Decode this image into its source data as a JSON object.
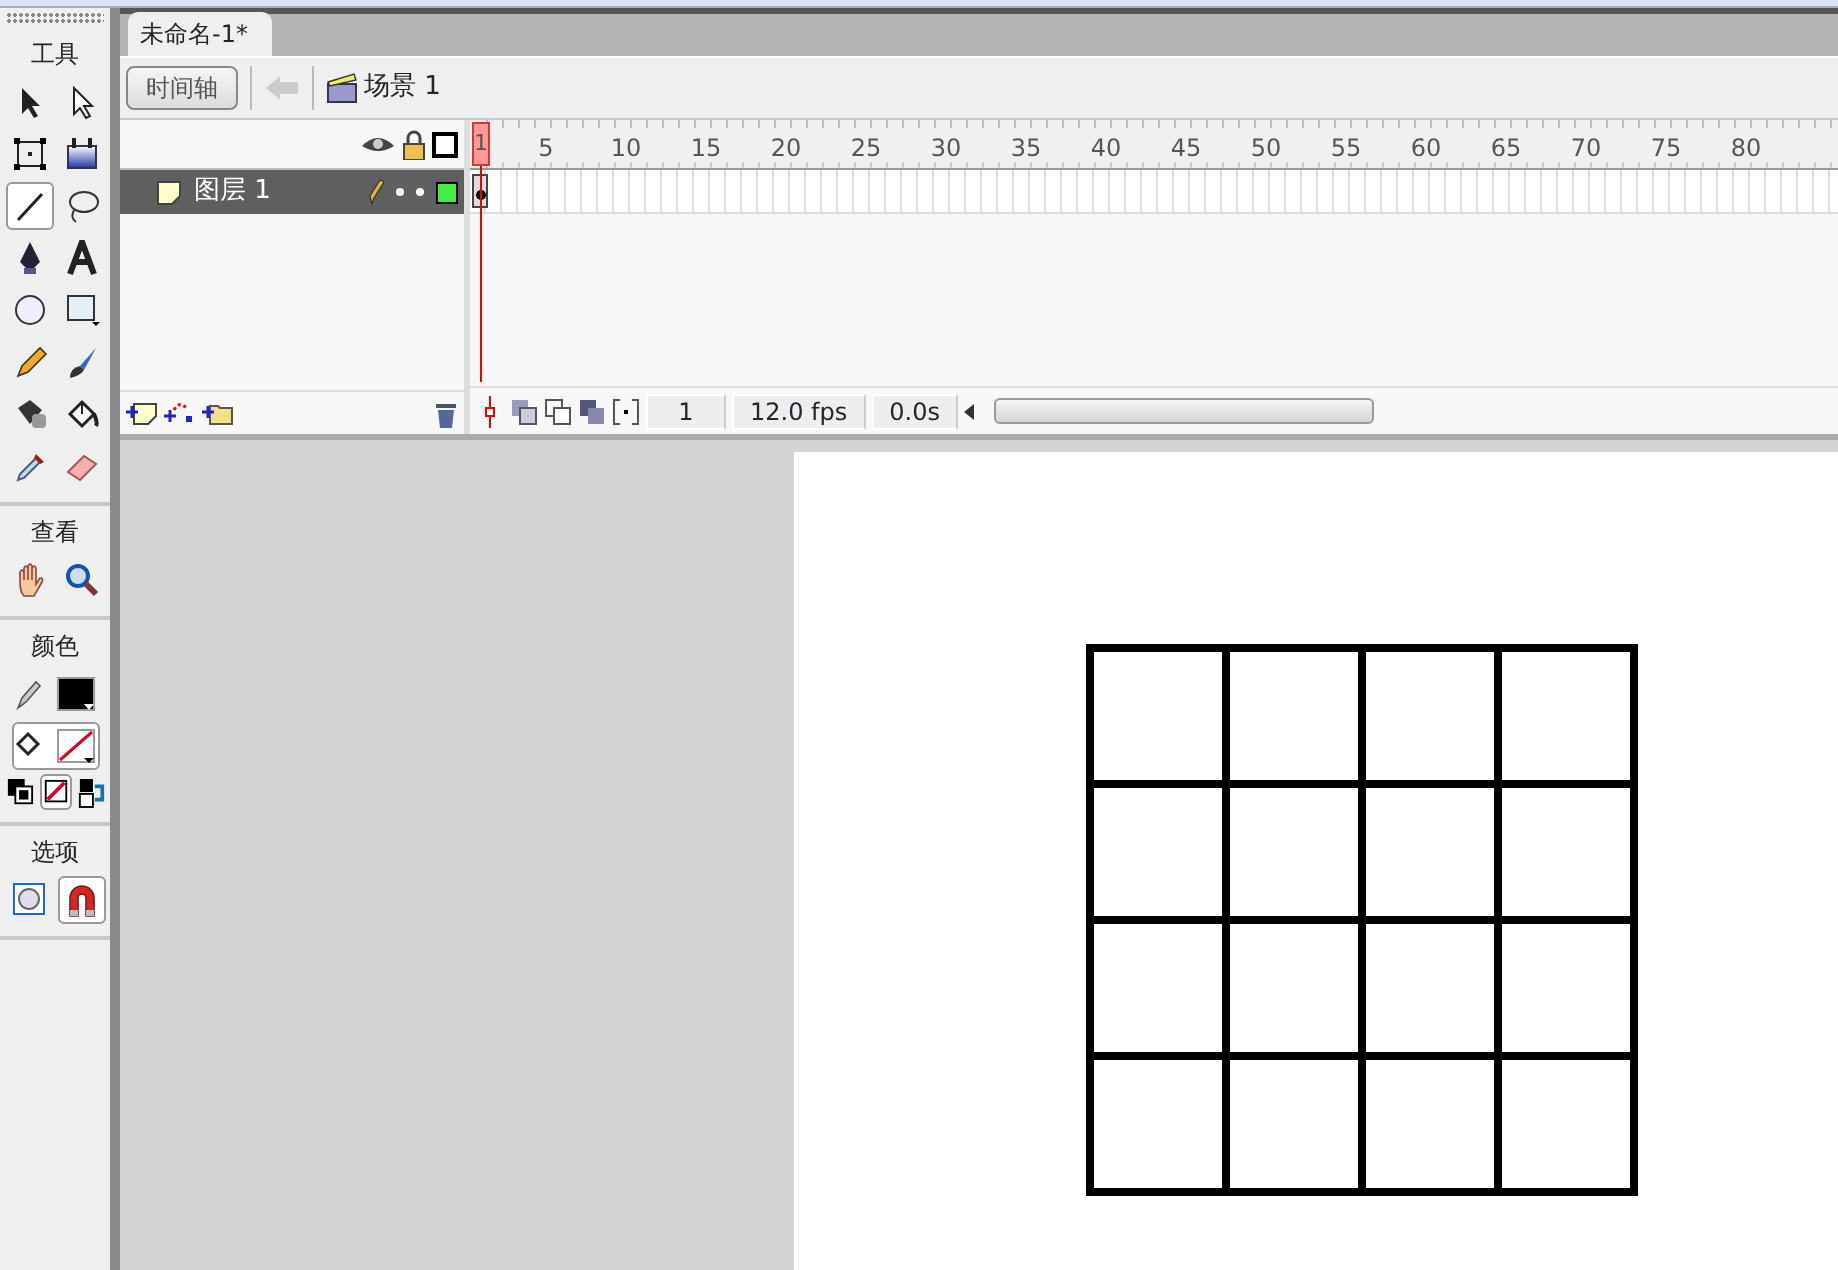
{
  "document_tab": {
    "title": "未命名-1*",
    "selected": true
  },
  "edit_bar": {
    "timeline_button": "时间轴",
    "scene": "场景 1"
  },
  "toolbox": [
    {
      "title": "工具",
      "rows": [
        [
          {
            "kind": "arrow",
            "selected": false
          },
          {
            "kind": "subselect",
            "selected": false
          }
        ],
        [
          {
            "kind": "free_transform",
            "selected": false
          },
          {
            "kind": "gradient_transform",
            "selected": false
          }
        ],
        [
          {
            "kind": "line",
            "selected": true
          },
          {
            "kind": "lasso",
            "selected": false
          }
        ],
        [
          {
            "kind": "pen",
            "selected": false
          },
          {
            "kind": "text",
            "selected": false
          }
        ],
        [
          {
            "kind": "oval",
            "selected": false
          },
          {
            "kind": "rectangle",
            "selected": false
          }
        ],
        [
          {
            "kind": "pencil",
            "selected": false
          },
          {
            "kind": "brush",
            "selected": false
          }
        ],
        [
          {
            "kind": "ink_bottle",
            "selected": false
          },
          {
            "kind": "paint_bucket",
            "selected": false
          }
        ],
        [
          {
            "kind": "eyedropper",
            "selected": false
          },
          {
            "kind": "eraser",
            "selected": false
          }
        ]
      ]
    },
    {
      "title": "查看",
      "rows": [
        [
          {
            "kind": "hand",
            "selected": false
          },
          {
            "kind": "zoom",
            "selected": false
          }
        ]
      ]
    },
    {
      "title": "颜色",
      "rows": [
        [
          {
            "kind": "stroke_color",
            "selected": false
          }
        ],
        [
          {
            "kind": "fill_color",
            "selected": true
          }
        ],
        [
          {
            "kind": "default_colors",
            "selected": false
          },
          {
            "kind": "no_color",
            "selected": true
          },
          {
            "kind": "swap_colors",
            "selected": false
          }
        ]
      ]
    },
    {
      "title": "选项",
      "rows": [
        [
          {
            "kind": "object_drawing",
            "selected": false
          },
          {
            "kind": "snap",
            "selected": true
          }
        ]
      ]
    }
  ],
  "timeline": {
    "ruler": [
      "1",
      "5",
      "10",
      "15",
      "20",
      "25",
      "30",
      "35",
      "40",
      "45",
      "50",
      "55",
      "60",
      "65",
      "70",
      "75",
      "80"
    ],
    "layers": [
      {
        "name": "图层 1",
        "selected": true,
        "color": "#44ee44"
      }
    ],
    "frame": "1",
    "frame_rate": "12.0 fps",
    "elapsed": "0.0s"
  }
}
